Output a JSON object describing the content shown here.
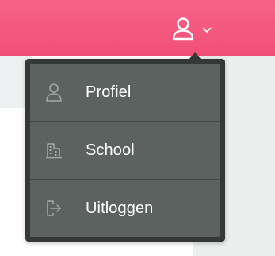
{
  "header": {
    "user_icon": "user-icon",
    "chevron_icon": "chevron-down-icon"
  },
  "user_menu": {
    "items": [
      {
        "label": "Profiel",
        "icon": "user-icon"
      },
      {
        "label": "School",
        "icon": "building-icon"
      },
      {
        "label": "Uitloggen",
        "icon": "logout-icon"
      }
    ]
  },
  "colors": {
    "header_background": "#f2577e",
    "menu_background": "#5c625f",
    "menu_border": "#343938",
    "menu_text": "#ffffff",
    "menu_icon": "#a4aaa7"
  }
}
